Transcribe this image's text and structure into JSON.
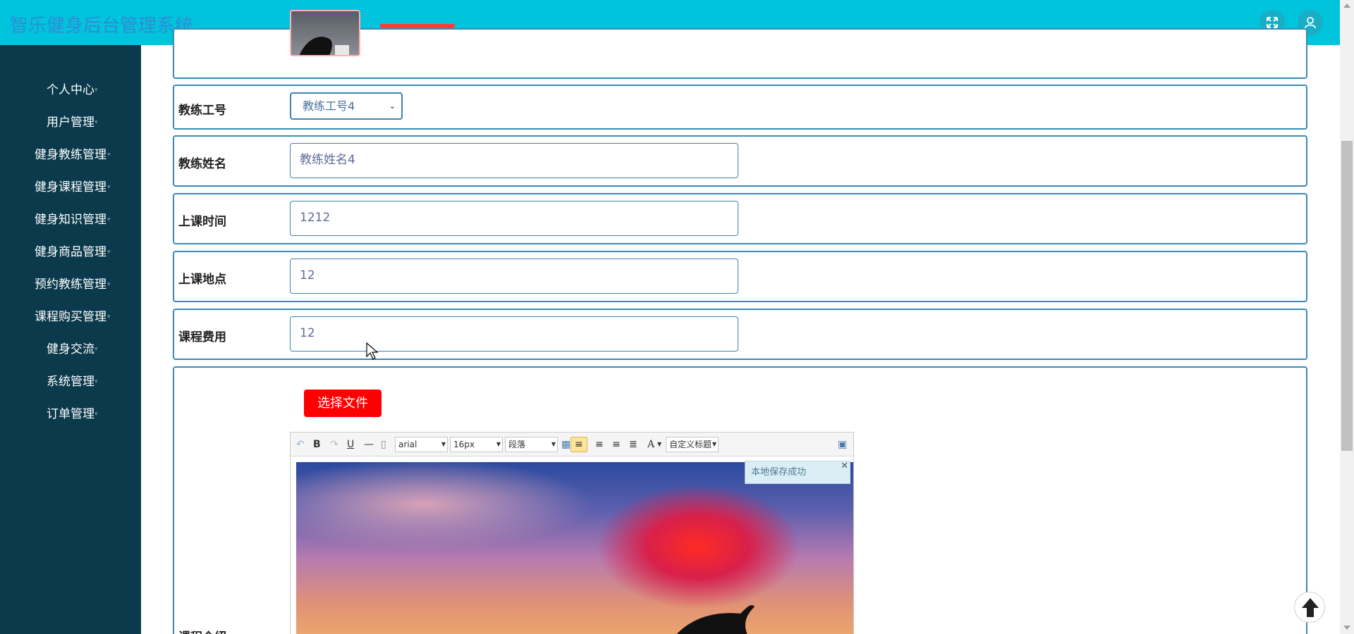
{
  "header": {
    "title": "智乐健身后台管理系统"
  },
  "icons": {
    "fullscreen": "fullscreen-icon",
    "user": "user-icon",
    "back_to_top": "arrow-up-icon"
  },
  "sidebar": {
    "items": [
      {
        "label": "个人中心"
      },
      {
        "label": "用户管理"
      },
      {
        "label": "健身教练管理"
      },
      {
        "label": "健身课程管理"
      },
      {
        "label": "健身知识管理"
      },
      {
        "label": "健身商品管理"
      },
      {
        "label": "预约教练管理"
      },
      {
        "label": "课程购买管理"
      },
      {
        "label": "健身交流"
      },
      {
        "label": "系统管理"
      },
      {
        "label": "订单管理"
      }
    ]
  },
  "form": {
    "coach_id": {
      "label": "教练工号",
      "value": "教练工号4"
    },
    "coach_name": {
      "label": "教练姓名",
      "value": "教练姓名4"
    },
    "class_time": {
      "label": "上课时间",
      "value": "1212"
    },
    "class_place": {
      "label": "上课地点",
      "value": "12"
    },
    "class_fee": {
      "label": "课程费用",
      "value": "12"
    },
    "intro": {
      "label": "课程介绍",
      "file_button": "选择文件"
    }
  },
  "editor": {
    "toolbar": {
      "font": "arial",
      "size": "16px",
      "paragraph": "段落",
      "custom_title": "自定义标题",
      "bold": "B",
      "underline": "U",
      "font_color": "A"
    },
    "toast": "本地保存成功"
  },
  "colors": {
    "header": "#00c3dc",
    "sidebar": "#0b3a4c",
    "border": "#3a8ab3",
    "button": "#ff0000"
  }
}
